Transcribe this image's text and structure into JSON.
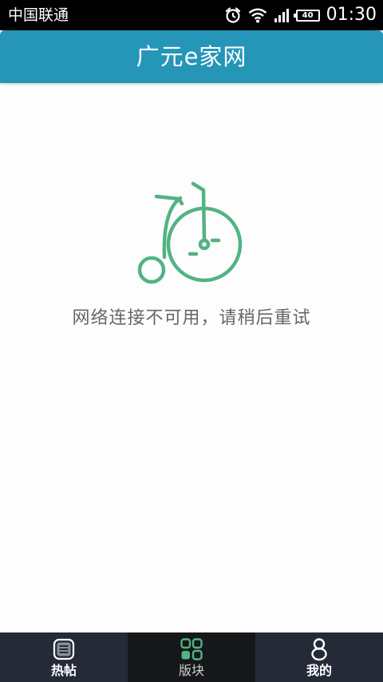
{
  "status_bar": {
    "carrier": "中国联通",
    "battery_level": "40",
    "time": "01:30",
    "icons": [
      "alarm-icon",
      "wifi-icon",
      "signal-icon",
      "battery-icon"
    ]
  },
  "header": {
    "title": "广元e家网",
    "background_color": "#2596b8"
  },
  "main": {
    "illustration": "bicycle-icon",
    "illustration_color": "#52b383",
    "error_message": "网络连接不可用，请稍后重试"
  },
  "bottom_nav": {
    "tabs": [
      {
        "label": "热帖",
        "icon": "list-icon",
        "active": false
      },
      {
        "label": "版块",
        "icon": "grid-icon",
        "active": true
      },
      {
        "label": "我的",
        "icon": "profile-icon",
        "active": false
      }
    ]
  }
}
